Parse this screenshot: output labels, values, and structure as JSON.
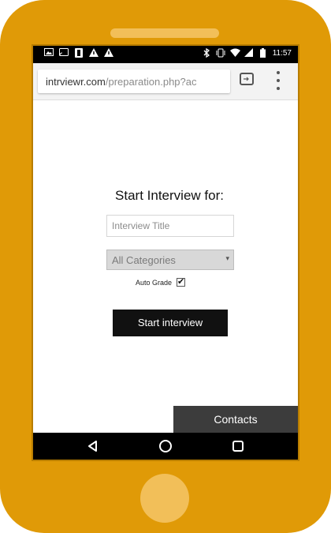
{
  "status_bar": {
    "left_icons": [
      "image-icon",
      "cast-icon",
      "notification-icon",
      "alert-icon",
      "alert-icon"
    ],
    "right_icons": [
      "bluetooth-icon",
      "vibrate-icon",
      "wifi-icon",
      "signal-icon",
      "battery-icon"
    ],
    "time": "11:57"
  },
  "browser": {
    "url_host": "intrviewr.com",
    "url_path": "/preparation.php?ac",
    "tabs_icon": "tabs-icon",
    "menu_icon": "more-vert-icon"
  },
  "form": {
    "heading": "Start Interview for:",
    "title_placeholder": "Interview Title",
    "category_selected": "All Categories",
    "autograde_label": "Auto Grade",
    "autograde_checked": true,
    "start_button": "Start interview"
  },
  "contacts_tab": "Contacts",
  "nav_bar": [
    "back-icon",
    "home-icon",
    "recents-icon"
  ],
  "colors": {
    "phone_body": "#e09a07",
    "phone_accent": "#f2bf59",
    "button_bg": "#111111",
    "contacts_bg": "#3c3c3c"
  }
}
